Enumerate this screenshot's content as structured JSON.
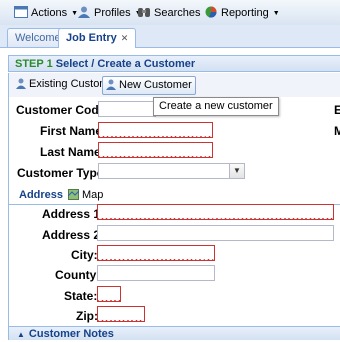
{
  "toolbar": {
    "items": [
      {
        "label": "Actions",
        "icon": "window-icon"
      },
      {
        "label": "Profiles",
        "icon": "person-icon"
      },
      {
        "label": "Searches",
        "icon": "binoculars-icon"
      },
      {
        "label": "Reporting",
        "icon": "pie-chart-icon"
      }
    ]
  },
  "tabs": [
    {
      "label": "Welcome"
    },
    {
      "label": "Job Entry",
      "close": "✕"
    }
  ],
  "step": {
    "prefix": "STEP 1",
    "title": "Select / Create a Customer"
  },
  "buttons": {
    "existing": "Existing Customer",
    "new": "New Customer"
  },
  "tooltip": "Create a new customer",
  "form": {
    "customer_code": {
      "label": "Customer Code:",
      "value": ""
    },
    "first_name": {
      "label": "First Name:",
      "value": ""
    },
    "last_name": {
      "label": "Last Name:",
      "value": ""
    },
    "customer_type": {
      "label": "Customer Type:",
      "value": ""
    }
  },
  "address_tabs": {
    "address": "Address",
    "map": "Map"
  },
  "address": {
    "address1": {
      "label": "Address 1:",
      "value": ""
    },
    "address2": {
      "label": "Address 2:",
      "value": ""
    },
    "city": {
      "label": "City:",
      "value": ""
    },
    "county": {
      "label": "County:",
      "value": ""
    },
    "state": {
      "label": "State:",
      "value": ""
    },
    "zip": {
      "label": "Zip:",
      "value": ""
    }
  },
  "notes": {
    "label": "Customer Notes"
  },
  "edge_labels": {
    "first": "E",
    "second": "M"
  },
  "colors": {
    "accent": "#15428b",
    "invalid": "#cc3333",
    "step": "#2b8a2b"
  }
}
